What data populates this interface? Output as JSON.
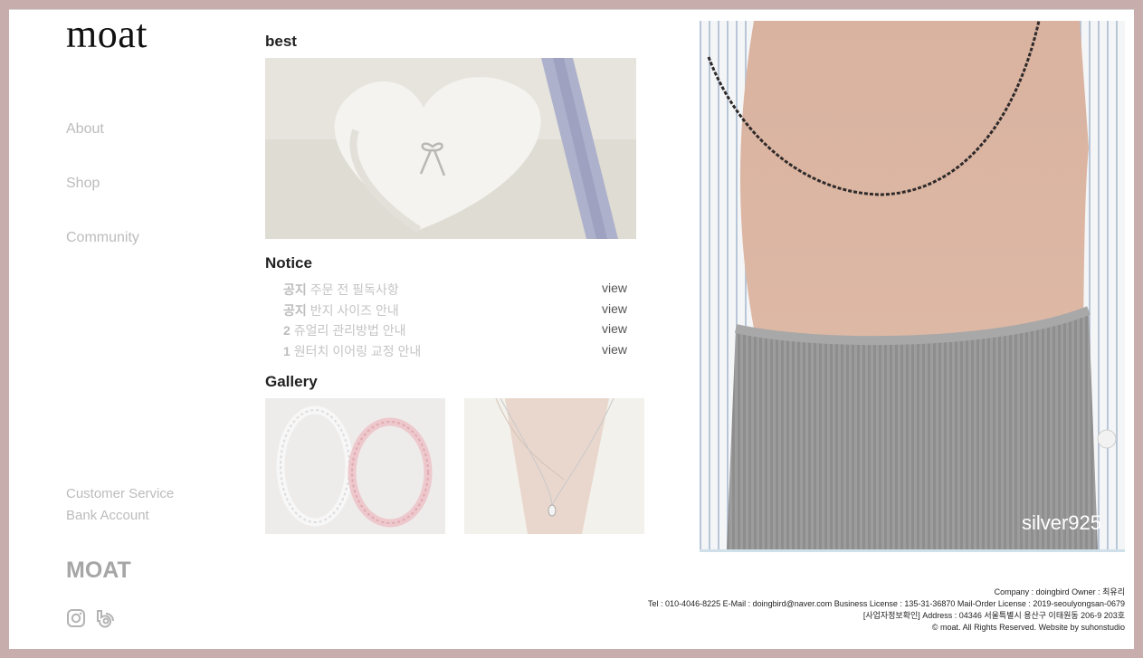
{
  "logo": "moat",
  "nav": [
    "About",
    "Shop",
    "Community"
  ],
  "service": [
    "Customer Service",
    "Bank Account"
  ],
  "brand": "MOAT",
  "social_icons": [
    "instagram-icon",
    "blog-icon"
  ],
  "sections": {
    "best": "best",
    "notice": "Notice",
    "gallery": "Gallery"
  },
  "notices": [
    {
      "tag": "공지",
      "title": "주문 전 필독사항",
      "action": "view"
    },
    {
      "tag": "공지",
      "title": "반지 사이즈 안내",
      "action": "view"
    },
    {
      "tag": "2",
      "title": "쥬얼리 관리방법 안내",
      "action": "view"
    },
    {
      "tag": "1",
      "title": "원터치 이어링 교정 안내",
      "action": "view"
    }
  ],
  "hero": {
    "caption": "silver925"
  },
  "footer": [
    "Company : doingbird Owner : 최유리",
    "Tel : 010-4046-8225 E-Mail : doingbird@naver.com Business License : 135-31-36870 Mail-Order License : 2019-seoulyongsan-0679",
    "[사업자정보확인] Address : 04346 서울특별시 용산구 이태원동 206-9 203호",
    "© moat. All Rights Reserved. Website by suhonstudio"
  ],
  "colors": {
    "frame": "#c7adab",
    "nav_text": "#bcbcbc",
    "brand_text": "#a6a6a6"
  }
}
